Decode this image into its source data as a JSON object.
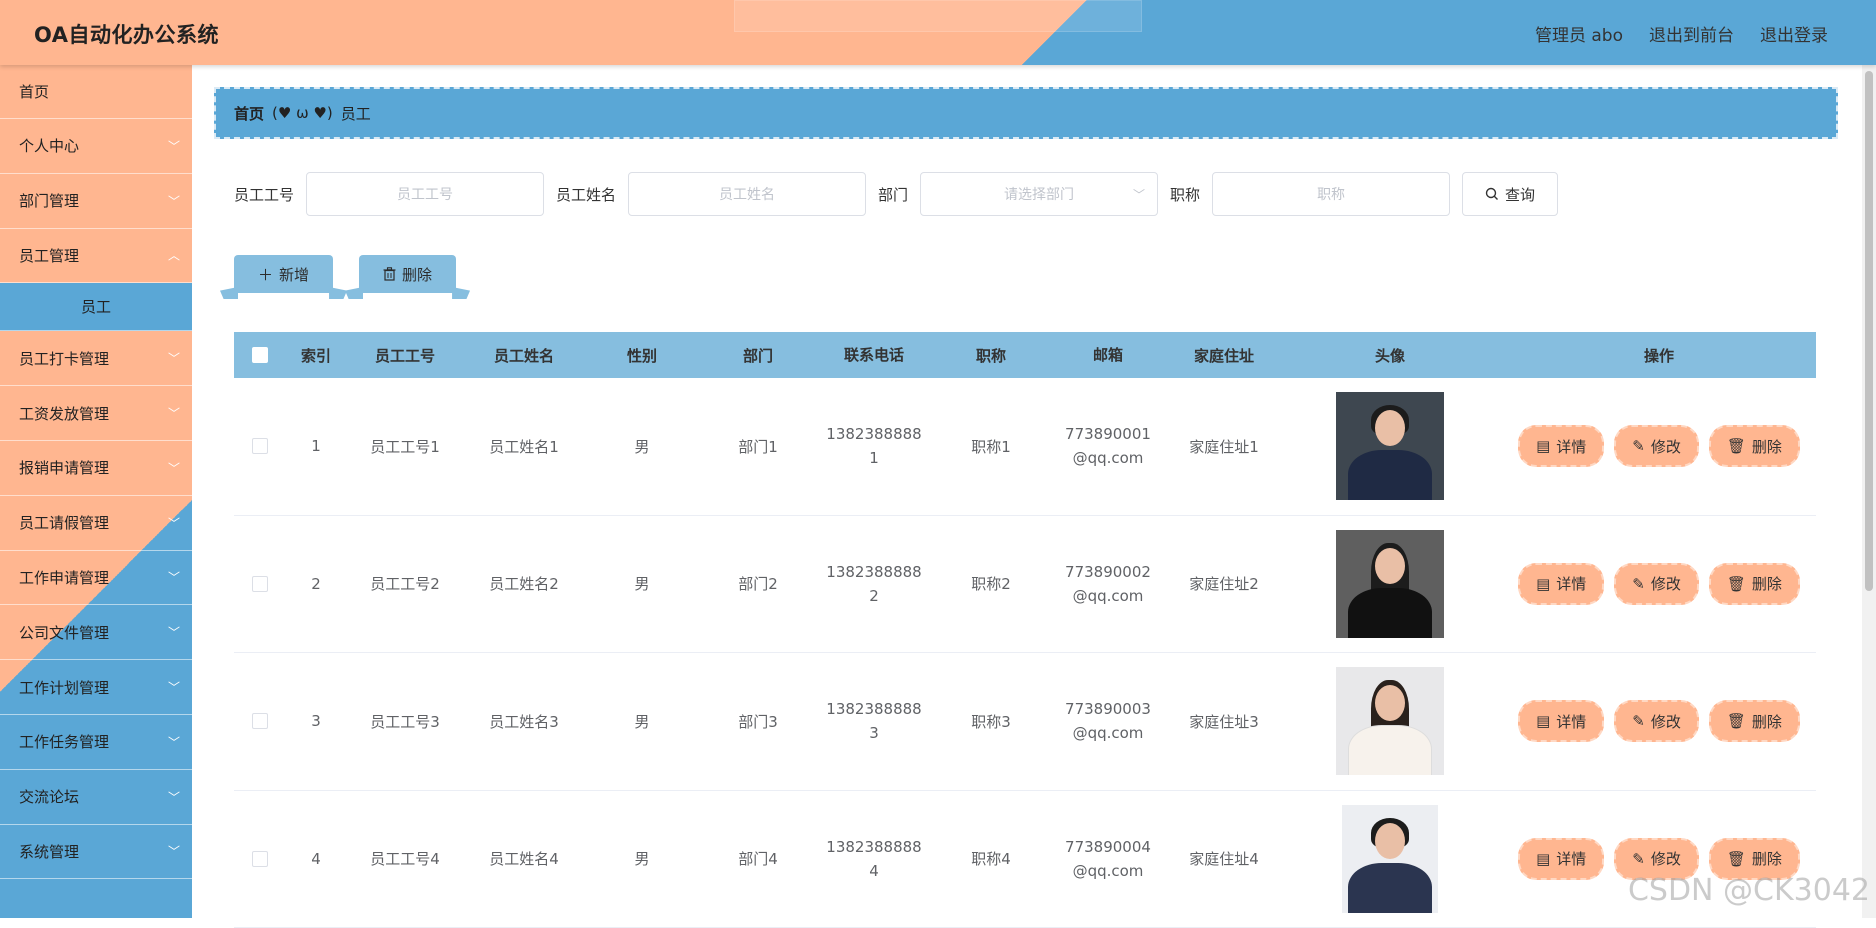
{
  "header": {
    "title": "OA自动化办公系统",
    "admin": "管理员 abo",
    "to_front": "退出到前台",
    "logout": "退出登录"
  },
  "sidebar": {
    "items": [
      {
        "label": "首页",
        "chevron": false
      },
      {
        "label": "个人中心",
        "chevron": true
      },
      {
        "label": "部门管理",
        "chevron": true
      },
      {
        "label": "员工管理",
        "chevron": true
      },
      {
        "label": "员工",
        "chevron": false,
        "sub": true
      },
      {
        "label": "员工打卡管理",
        "chevron": true
      },
      {
        "label": "工资发放管理",
        "chevron": true
      },
      {
        "label": "报销申请管理",
        "chevron": true
      },
      {
        "label": "员工请假管理",
        "chevron": true
      },
      {
        "label": "工作申请管理",
        "chevron": true
      },
      {
        "label": "公司文件管理",
        "chevron": true
      },
      {
        "label": "工作计划管理",
        "chevron": true
      },
      {
        "label": "工作任务管理",
        "chevron": true
      },
      {
        "label": "交流论坛",
        "chevron": true
      },
      {
        "label": "系统管理",
        "chevron": true
      }
    ]
  },
  "breadcrumb": {
    "home": "首页",
    "sep": "(♥ ω ♥)",
    "current": "员工"
  },
  "search": {
    "no_label": "员工工号",
    "no_placeholder": "员工工号",
    "name_label": "员工姓名",
    "name_placeholder": "员工姓名",
    "dept_label": "部门",
    "dept_placeholder": "请选择部门",
    "title_label": "职称",
    "title_placeholder": "职称",
    "query_label": "查询"
  },
  "actions": {
    "add_label": "新增",
    "delete_label": "删除"
  },
  "table": {
    "headers": [
      "索引",
      "员工工号",
      "员工姓名",
      "性别",
      "部门",
      "联系电话",
      "职称",
      "邮箱",
      "家庭住址",
      "头像",
      "操作"
    ],
    "rows": [
      {
        "index": "1",
        "no": "员工工号1",
        "name": "员工姓名1",
        "sex": "男",
        "dept": "部门1",
        "tel_a": "1382388888",
        "tel_b": "1",
        "title": "职称1",
        "mail_a": "773890001",
        "mail_b": "@qq.com",
        "addr": "家庭住址1"
      },
      {
        "index": "2",
        "no": "员工工号2",
        "name": "员工姓名2",
        "sex": "男",
        "dept": "部门2",
        "tel_a": "1382388888",
        "tel_b": "2",
        "title": "职称2",
        "mail_a": "773890002",
        "mail_b": "@qq.com",
        "addr": "家庭住址2"
      },
      {
        "index": "3",
        "no": "员工工号3",
        "name": "员工姓名3",
        "sex": "男",
        "dept": "部门3",
        "tel_a": "1382388888",
        "tel_b": "3",
        "title": "职称3",
        "mail_a": "773890003",
        "mail_b": "@qq.com",
        "addr": "家庭住址3"
      },
      {
        "index": "4",
        "no": "员工工号4",
        "name": "员工姓名4",
        "sex": "男",
        "dept": "部门4",
        "tel_a": "1382388888",
        "tel_b": "4",
        "title": "职称4",
        "mail_a": "773890004",
        "mail_b": "@qq.com",
        "addr": "家庭住址4"
      }
    ],
    "ops": {
      "detail": "详情",
      "edit": "修改",
      "delete": "删除"
    }
  },
  "watermark": "CSDN @CK3042",
  "colors": {
    "peach": "#FFB690",
    "blue": "#5AA7D6",
    "light_blue": "#86BEDF"
  }
}
